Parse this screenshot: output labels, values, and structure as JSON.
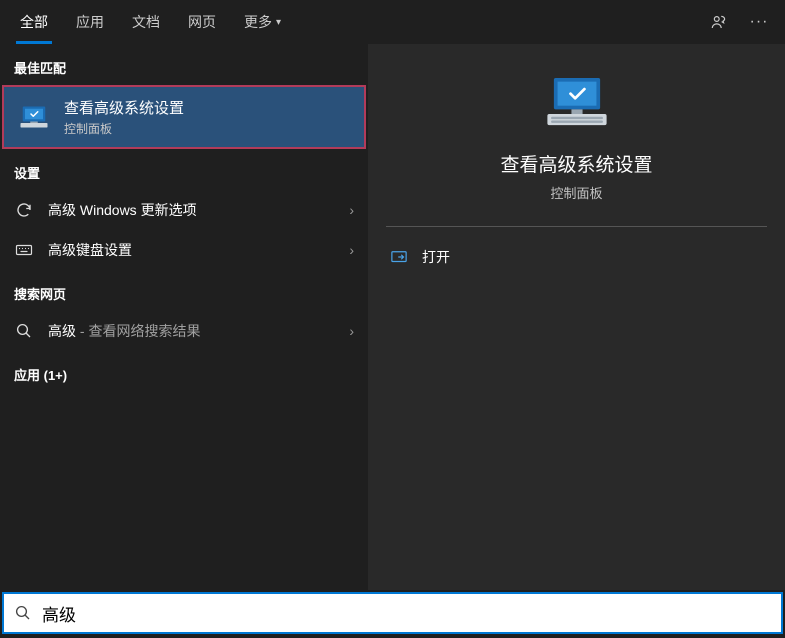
{
  "tabs": {
    "all": "全部",
    "apps": "应用",
    "docs": "文档",
    "web": "网页",
    "more": "更多"
  },
  "sections": {
    "best_match": "最佳匹配",
    "settings": "设置",
    "web_search": "搜索网页",
    "apps_bucket": "应用 (1+)"
  },
  "best_match": {
    "title": "查看高级系统设置",
    "subtitle": "控制面板"
  },
  "settings_items": [
    {
      "label": "高级 Windows 更新选项"
    },
    {
      "label": "高级键盘设置"
    }
  ],
  "web_items": {
    "prefix": "高级",
    "suffix": " - 查看网络搜索结果"
  },
  "preview": {
    "title": "查看高级系统设置",
    "subtitle": "控制面板",
    "open": "打开"
  },
  "search": {
    "value": "高级"
  }
}
